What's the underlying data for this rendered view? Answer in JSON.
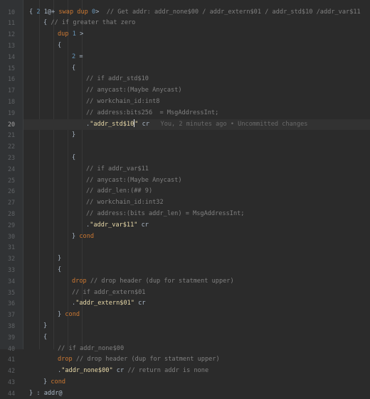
{
  "editor": {
    "current_line": 20,
    "blame_text": "You, 2 minutes ago • Uncommitted changes",
    "lines": [
      {
        "n": 10,
        "indent": 0,
        "tokens": [
          [
            "def",
            "{ "
          ],
          [
            "num",
            "2 "
          ],
          [
            "def",
            "1@+ "
          ],
          [
            "kw",
            "swap dup "
          ],
          [
            "num",
            "0"
          ],
          [
            "def",
            "> "
          ],
          [
            "cm",
            " // Get addr: addr_none$00 / addr_extern$01 / addr_std$10 /addr_var$11"
          ]
        ]
      },
      {
        "n": 11,
        "indent": 1,
        "tokens": [
          [
            "def",
            "{ "
          ],
          [
            "cm",
            "// if greater that zero"
          ]
        ]
      },
      {
        "n": 12,
        "indent": 2,
        "tokens": [
          [
            "kw",
            "dup "
          ],
          [
            "num",
            "1 "
          ],
          [
            "def",
            ">"
          ]
        ]
      },
      {
        "n": 13,
        "indent": 2,
        "tokens": [
          [
            "def",
            "{"
          ]
        ]
      },
      {
        "n": 14,
        "indent": 3,
        "tokens": [
          [
            "num",
            "2 "
          ],
          [
            "def",
            "="
          ]
        ]
      },
      {
        "n": 15,
        "indent": 3,
        "tokens": [
          [
            "def",
            "{"
          ]
        ]
      },
      {
        "n": 16,
        "indent": 4,
        "tokens": [
          [
            "cm",
            "// if addr_std$10"
          ]
        ]
      },
      {
        "n": 17,
        "indent": 4,
        "tokens": [
          [
            "cm",
            "// anycast:(Maybe Anycast)"
          ]
        ]
      },
      {
        "n": 18,
        "indent": 4,
        "tokens": [
          [
            "cm",
            "// workchain_id:int8"
          ]
        ]
      },
      {
        "n": 19,
        "indent": 4,
        "tokens": [
          [
            "cm",
            "// address:bits256  = MsgAddressInt;"
          ]
        ]
      },
      {
        "n": 20,
        "indent": 4,
        "tokens": [
          [
            "def",
            "."
          ],
          [
            "str",
            "\"addr_std$10"
          ],
          [
            "caret",
            ""
          ],
          [
            "str",
            "\""
          ],
          [
            "def",
            " cr"
          ]
        ],
        "blame": true
      },
      {
        "n": 21,
        "indent": 3,
        "tokens": [
          [
            "def",
            "}"
          ]
        ]
      },
      {
        "n": 22,
        "indent": 0,
        "tokens": []
      },
      {
        "n": 23,
        "indent": 3,
        "tokens": [
          [
            "def",
            "{"
          ]
        ]
      },
      {
        "n": 24,
        "indent": 4,
        "tokens": [
          [
            "cm",
            "// if addr_var$11"
          ]
        ]
      },
      {
        "n": 25,
        "indent": 4,
        "tokens": [
          [
            "cm",
            "// anycast:(Maybe Anycast)"
          ]
        ]
      },
      {
        "n": 26,
        "indent": 4,
        "tokens": [
          [
            "cm",
            "// addr_len:(## 9)"
          ]
        ]
      },
      {
        "n": 27,
        "indent": 4,
        "tokens": [
          [
            "cm",
            "// workchain_id:int32"
          ]
        ]
      },
      {
        "n": 28,
        "indent": 4,
        "tokens": [
          [
            "cm",
            "// address:(bits addr_len) = MsgAddressInt;"
          ]
        ]
      },
      {
        "n": 29,
        "indent": 4,
        "tokens": [
          [
            "def",
            "."
          ],
          [
            "str",
            "\"addr_var$11\""
          ],
          [
            "def",
            " cr"
          ]
        ]
      },
      {
        "n": 30,
        "indent": 3,
        "tokens": [
          [
            "def",
            "} "
          ],
          [
            "kw",
            "cond"
          ]
        ]
      },
      {
        "n": 31,
        "indent": 0,
        "tokens": []
      },
      {
        "n": 32,
        "indent": 2,
        "tokens": [
          [
            "def",
            "}"
          ]
        ]
      },
      {
        "n": 33,
        "indent": 2,
        "tokens": [
          [
            "def",
            "{"
          ]
        ]
      },
      {
        "n": 34,
        "indent": 3,
        "tokens": [
          [
            "kw",
            "drop "
          ],
          [
            "cm",
            "// drop header (dup for statment upper)"
          ]
        ]
      },
      {
        "n": 35,
        "indent": 3,
        "tokens": [
          [
            "cm",
            "// if addr_extern$01"
          ]
        ]
      },
      {
        "n": 36,
        "indent": 3,
        "tokens": [
          [
            "def",
            "."
          ],
          [
            "str",
            "\"addr_extern$01\""
          ],
          [
            "def",
            " cr"
          ]
        ]
      },
      {
        "n": 37,
        "indent": 2,
        "tokens": [
          [
            "def",
            "} "
          ],
          [
            "kw",
            "cond"
          ]
        ]
      },
      {
        "n": 38,
        "indent": 1,
        "tokens": [
          [
            "def",
            "}"
          ]
        ]
      },
      {
        "n": 39,
        "indent": 1,
        "tokens": [
          [
            "def",
            "{"
          ]
        ]
      },
      {
        "n": 40,
        "indent": 2,
        "tokens": [
          [
            "cm",
            "// if addr_none$00"
          ]
        ]
      },
      {
        "n": 41,
        "indent": 2,
        "tokens": [
          [
            "kw",
            "drop "
          ],
          [
            "cm",
            "// drop header (dup for statment upper)"
          ]
        ]
      },
      {
        "n": 42,
        "indent": 2,
        "tokens": [
          [
            "def",
            "."
          ],
          [
            "str",
            "\"addr_none$00\""
          ],
          [
            "def",
            " cr "
          ],
          [
            "cm",
            "// return addr is none"
          ]
        ]
      },
      {
        "n": 43,
        "indent": 1,
        "tokens": [
          [
            "def",
            "} "
          ],
          [
            "kw",
            "cond"
          ]
        ]
      },
      {
        "n": 44,
        "indent": 0,
        "tokens": [
          [
            "def",
            "} : addr@"
          ]
        ]
      }
    ]
  }
}
